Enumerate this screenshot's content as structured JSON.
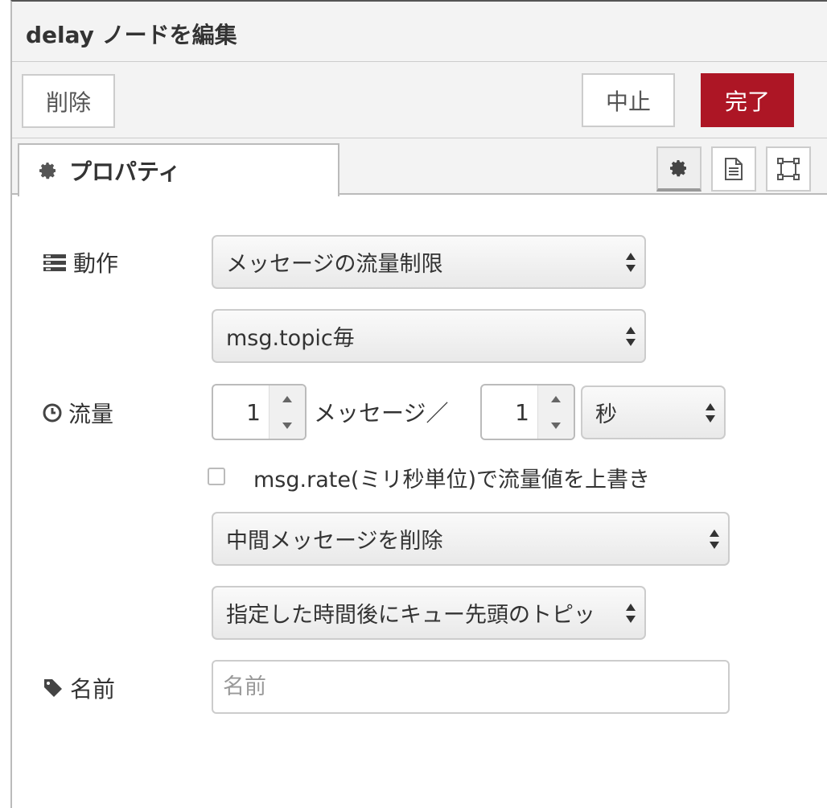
{
  "header": {
    "title": "delay ノードを編集"
  },
  "toolbar": {
    "delete_label": "削除",
    "cancel_label": "中止",
    "done_label": "完了"
  },
  "tabs": {
    "properties_label": "プロパティ"
  },
  "form": {
    "action_label": "動作",
    "action_value": "メッセージの流量制限",
    "scope_value": "msg.topic毎",
    "rate_label": "流量",
    "rate_count": "1",
    "rate_unit_text": "メッセージ／",
    "rate_interval": "1",
    "rate_interval_unit": "秒",
    "override_label": "msg.rate(ミリ秒単位)で流量値を上書き",
    "drop_value": "中間メッセージを削除",
    "queue_value": "指定した時間後にキュー先頭のトピッ",
    "name_label": "名前",
    "name_placeholder": "名前",
    "name_value": ""
  },
  "colors": {
    "primary": "#ad1625",
    "panel": "#f3f3f3",
    "border": "#cccccc"
  }
}
